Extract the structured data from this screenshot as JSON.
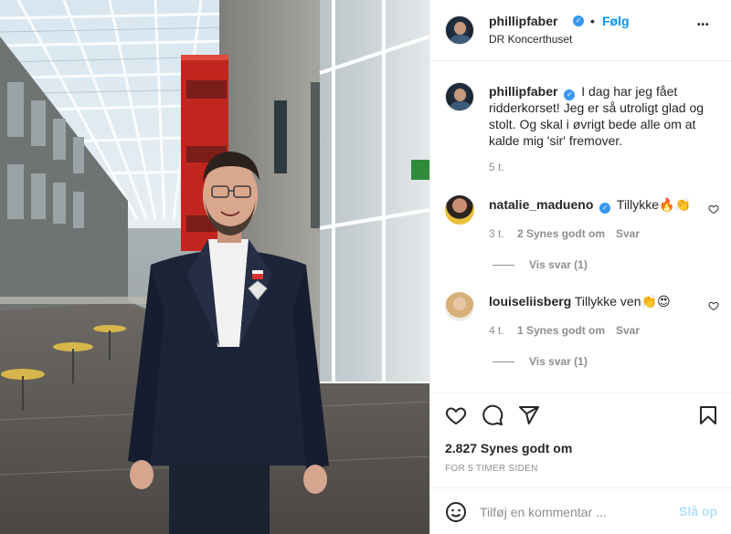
{
  "post": {
    "author": "phillipfaber",
    "follow_label": "Følg",
    "separator": "•",
    "location": "DR Koncerthuset",
    "more_label": "•••",
    "photo_alt": "Post photo"
  },
  "caption": {
    "author": "phillipfaber",
    "text": "I dag har jeg fået ridderkorset! Jeg er så utroligt glad og stolt. Og skal i øvrigt bede alle om at kalde mig 'sir' fremover.",
    "line1": "I dag har jeg fået",
    "line2": "ridderkorset! Jeg er så utroligt glad og",
    "line3": "stolt. Og skal i øvrigt bede alle om at",
    "line4": "kalde mig 'sir' fremover.",
    "age": "5 t."
  },
  "comments": [
    {
      "user": "natalie_madueno",
      "verified": true,
      "text": "Tillykke",
      "emojis": [
        "fire",
        "clapping-hands"
      ],
      "age": "3 t.",
      "likes": "2 Synes godt om",
      "reply_label": "Svar",
      "view_replies": "Vis svar (1)"
    },
    {
      "user": "louiseliisberg",
      "verified": false,
      "text": "Tillykke ven",
      "emojis": [
        "clapping-hands",
        "heart-eyes"
      ],
      "age": "4 t.",
      "likes": "1 Synes godt om",
      "reply_label": "Svar",
      "view_replies": "Vis svar (1)"
    }
  ],
  "actions": {
    "icons": [
      "heart-icon",
      "comment-icon",
      "share-icon",
      "bookmark-icon"
    ],
    "likes": "2.827 Synes godt om",
    "timestamp": "FOR 5 TIMER SIDEN"
  },
  "comment_box": {
    "placeholder": "Tilføj en kommentar ...",
    "post_label": "Slå op",
    "emoji_icon": "smiley-icon"
  },
  "colors": {
    "accent": "#0095f6",
    "verified": "#3897f0",
    "muted": "#8e8e8e",
    "post_disabled": "#b2dffc"
  }
}
